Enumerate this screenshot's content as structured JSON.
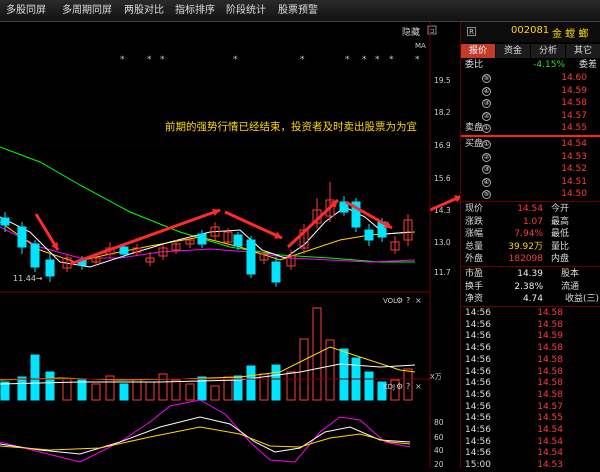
{
  "toolbar": {
    "items": [
      "多股同屏",
      "多周期同屏",
      "两股对比",
      "指标排序",
      "阶段统计",
      "股票预警"
    ]
  },
  "chart": {
    "hide_label": "隐藏",
    "unit_label": "MA",
    "annotation": "前期的强势行情已经结束，投资者及时卖出股票为为宜",
    "low_label": "11.44→",
    "price_ticks": [
      "19.5",
      "18.2",
      "16.9",
      "15.6",
      "14.3",
      "13.0",
      "11.7"
    ],
    "vol_label": "VOL",
    "vol_unit": "X万",
    "kdj_label": "KDJ",
    "kdj_ticks": [
      "80",
      "60",
      "40",
      "20"
    ],
    "colors": {
      "up": "#ff3b3b",
      "down": "#00e5ff",
      "ma1": "#ffffff",
      "ma2": "#ffd700",
      "ma3": "#ff00ff",
      "ma4": "#00ff00",
      "arrow": "#ff2a2a"
    }
  },
  "sidebar": {
    "badge": "R",
    "code": "002081",
    "name": "金 螳 螂",
    "tabs": [
      "报价",
      "资金",
      "分析",
      "其它"
    ],
    "wei": {
      "label": "委比",
      "value": "-4.15%",
      "label2": "委差"
    },
    "sell": [
      {
        "label": "",
        "num": "⑤",
        "price": "14.60"
      },
      {
        "label": "",
        "num": "④",
        "price": "14.59"
      },
      {
        "label": "",
        "num": "③",
        "price": "14.58"
      },
      {
        "label": "",
        "num": "②",
        "price": "14.57"
      },
      {
        "label": "卖盘",
        "num": "①",
        "price": "14.55"
      }
    ],
    "buy": [
      {
        "label": "买盘",
        "num": "①",
        "price": "14.54"
      },
      {
        "label": "",
        "num": "②",
        "price": "14.53"
      },
      {
        "label": "",
        "num": "③",
        "price": "14.52"
      },
      {
        "label": "",
        "num": "④",
        "price": "14.51"
      },
      {
        "label": "",
        "num": "⑤",
        "price": "14.50"
      }
    ],
    "stats": [
      {
        "label": "现价",
        "value": "14.54",
        "label2": "今开",
        "cls": "red"
      },
      {
        "label": "涨跌",
        "value": "1.07",
        "label2": "最高",
        "cls": "red"
      },
      {
        "label": "涨幅",
        "value": "7.94%",
        "label2": "最低",
        "cls": "red"
      },
      {
        "label": "总量",
        "value": "39.92万",
        "label2": "量比",
        "cls": "yel"
      },
      {
        "label": "外盘",
        "value": "182098",
        "label2": "内盘",
        "cls": "red"
      },
      {
        "label": "市盈",
        "value": "14.39",
        "label2": "股本",
        "cls": "wht"
      },
      {
        "label": "换手",
        "value": "2.38%",
        "label2": "流通",
        "cls": "wht"
      },
      {
        "label": "净资",
        "value": "4.74",
        "label2": "收益(三)",
        "cls": "wht"
      }
    ],
    "ticks": [
      {
        "time": "14:56",
        "price": "14.58"
      },
      {
        "time": "14:56",
        "price": "14.58"
      },
      {
        "time": "14:56",
        "price": "14.59"
      },
      {
        "time": "14:56",
        "price": "14.58"
      },
      {
        "time": "14:56",
        "price": "14.58"
      },
      {
        "time": "14:56",
        "price": "14.58"
      },
      {
        "time": "14:56",
        "price": "14.58"
      },
      {
        "time": "14:56",
        "price": "14.58"
      },
      {
        "time": "14:56",
        "price": "14.57"
      },
      {
        "time": "14:56",
        "price": "14.55"
      },
      {
        "time": "14:56",
        "price": "14.54"
      },
      {
        "time": "14:56",
        "price": "14.54"
      },
      {
        "time": "14:56",
        "price": "14.54"
      },
      {
        "time": "15:00",
        "price": "14.53"
      }
    ]
  }
}
